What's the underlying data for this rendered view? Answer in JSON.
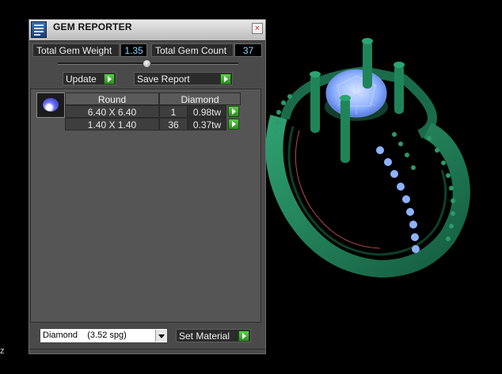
{
  "window": {
    "title": "GEM REPORTER",
    "close_glyph": "×"
  },
  "summary": {
    "total_weight_label": "Total Gem Weight",
    "total_weight_value": "1.35",
    "total_count_label": "Total Gem Count",
    "total_count_value": "37"
  },
  "toolbar": {
    "update_label": "Update",
    "save_report_label": "Save Report"
  },
  "gem_table": {
    "shape_header": "Round",
    "material_header": "Diamond",
    "rows": [
      {
        "size": "6.40 X 6.40",
        "count": "1",
        "weight": "0.98tw"
      },
      {
        "size": "1.40 X 1.40",
        "count": "36",
        "weight": "0.37tw"
      }
    ]
  },
  "material_selector": {
    "selected": "Diamond    (3.52 spg)",
    "button_label": "Set Material"
  },
  "corner_text": "z",
  "colors": {
    "ring_green": "#1f7a55",
    "gem_blue": "#8fb2ff",
    "accent_go": "#3fae31",
    "value_text": "#8fd6ff"
  },
  "icons": [
    "app-icon",
    "close-icon",
    "slider-thumb",
    "go-arrow-icon",
    "round-gem-icon",
    "dropdown-arrow-icon"
  ]
}
